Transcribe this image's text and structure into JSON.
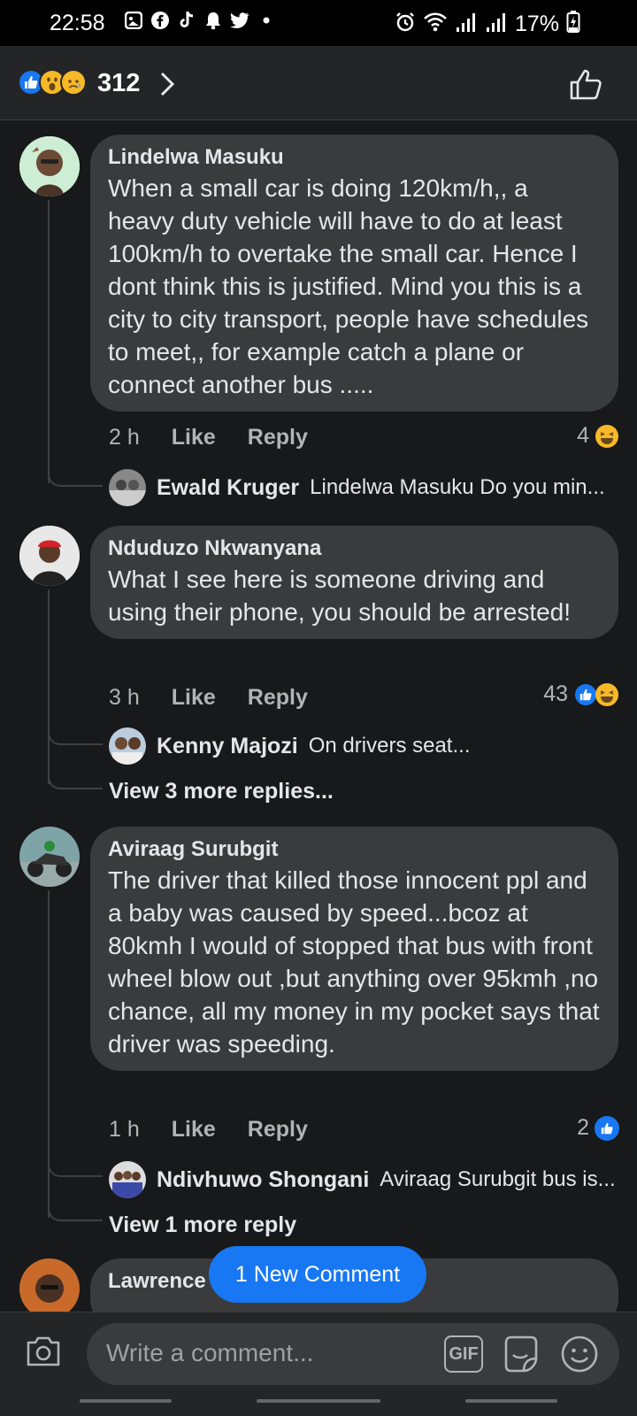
{
  "status_bar": {
    "time": "22:58",
    "battery": "17%"
  },
  "header": {
    "reaction_count": "312"
  },
  "comments": [
    {
      "author": "Lindelwa Masuku",
      "text": "When a small car is doing 120km/h,, a heavy duty vehicle will have to do at least 100km/h to overtake the small car. Hence I dont think this is justified. Mind you this is a city to city transport, people have schedules to meet,, for example catch a plane or connect another bus .....",
      "time": "2 h",
      "like_label": "Like",
      "reply_label": "Reply",
      "reaction_count": "4",
      "replies": [
        {
          "author": "Ewald Kruger",
          "preview": "Lindelwa Masuku Do you min..."
        }
      ]
    },
    {
      "author": "Nduduzo Nkwanyana",
      "text": "What I see here is someone driving and using their phone, you should be arrested!",
      "time": "3 h",
      "like_label": "Like",
      "reply_label": "Reply",
      "reaction_count": "43",
      "replies": [
        {
          "author": "Kenny Majozi",
          "preview": "On drivers seat..."
        }
      ],
      "view_more": "View 3 more replies..."
    },
    {
      "author": "Aviraag Surubgit",
      "text": "The driver that killed those innocent ppl and a baby was caused by speed...bcoz at 80kmh I would of stopped that bus with front wheel blow out ,but anything over 95kmh ,no chance, all my money in my pocket says that driver was speeding.",
      "time": "1 h",
      "like_label": "Like",
      "reply_label": "Reply",
      "reaction_count": "2",
      "replies": [
        {
          "author": "Ndivhuwo Shongani",
          "preview": "Aviraag Surubgit bus is..."
        }
      ],
      "view_more": "View 1 more reply"
    },
    {
      "author": "Lawrence Manga Magonga"
    }
  ],
  "new_comment_pill": "1 New Comment",
  "composer": {
    "placeholder": "Write a comment...",
    "gif_label": "GIF"
  },
  "colors": {
    "accent": "#1877f2",
    "background": "#18191a",
    "bubble": "#3a3b3c"
  }
}
